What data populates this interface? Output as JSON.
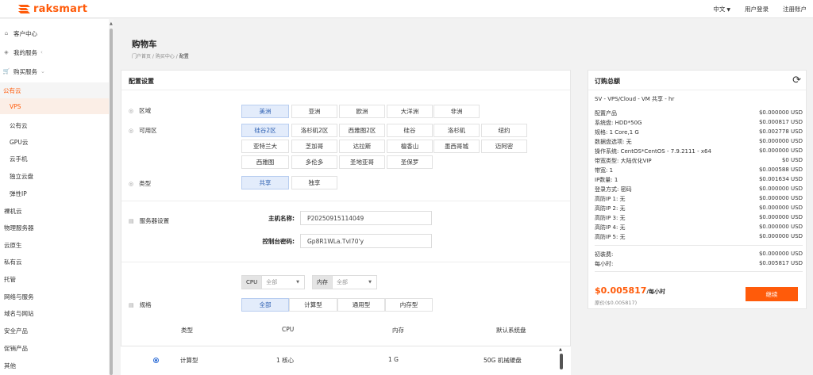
{
  "brand": {
    "name": "raksmart",
    "color": "#ff5b0a"
  },
  "topnav": {
    "language": "中文",
    "login": "用户登录",
    "register": "注册账户"
  },
  "sidebar": {
    "items": [
      {
        "label": "客户中心",
        "icon": "home-icon"
      },
      {
        "label": "我的服务",
        "icon": "cube-icon"
      },
      {
        "label": "购买服务",
        "icon": "cart-icon"
      },
      {
        "label": "公有云"
      },
      {
        "label": "VPS"
      },
      {
        "label": "公有云"
      },
      {
        "label": "GPU云"
      },
      {
        "label": "云手机"
      },
      {
        "label": "独立云盘"
      },
      {
        "label": "弹性IP"
      },
      {
        "label": "裸机云"
      },
      {
        "label": "物理服务器"
      },
      {
        "label": "云原生"
      },
      {
        "label": "私有云"
      },
      {
        "label": "托管"
      },
      {
        "label": "网络与服务"
      },
      {
        "label": "域名与网站"
      },
      {
        "label": "安全产品"
      },
      {
        "label": "促销产品"
      },
      {
        "label": "其他"
      }
    ]
  },
  "page": {
    "title": "购物车",
    "breadcrumb": [
      "门户首页",
      "购买中心",
      "配置"
    ]
  },
  "config": {
    "title": "配置设置",
    "region": {
      "label": "区域",
      "options": [
        "美洲",
        "亚洲",
        "欧洲",
        "大洋洲",
        "非洲"
      ],
      "selected": "美洲"
    },
    "zone": {
      "label": "可用区",
      "options": [
        "硅谷2区",
        "洛杉矶2区",
        "西雅图2区",
        "硅谷",
        "洛杉矶",
        "纽约",
        "亚特兰大",
        "芝加哥",
        "达拉斯",
        "檀香山",
        "墨西哥城",
        "迈阿密",
        "西雅图",
        "多伦多",
        "圣地亚哥",
        "圣保罗"
      ],
      "selected": "硅谷2区"
    },
    "type": {
      "label": "类型",
      "options": [
        "共享",
        "独享"
      ],
      "selected": "共享"
    },
    "server": {
      "label": "服务器设置",
      "hostname_label": "主机名称:",
      "hostname": "P20250915114049",
      "password_label": "控制台密码:",
      "password": "Gp8R1WLa.Tvl70'y"
    },
    "spec": {
      "label": "规格",
      "cpu_filter": {
        "label": "CPU",
        "value": "全部"
      },
      "mem_filter": {
        "label": "内存",
        "value": "全部"
      },
      "tabs": [
        "全部",
        "计算型",
        "通用型",
        "内存型"
      ],
      "selected_tab": "全部",
      "columns": [
        "类型",
        "CPU",
        "内存",
        "默认系统盘"
      ],
      "rows": [
        {
          "type": "计算型",
          "cpu": "1 核心",
          "mem": "1 G",
          "disk": "50G 机械硬盘"
        }
      ]
    }
  },
  "summary": {
    "title": "订购总额",
    "product": "SV - VPS/Cloud - VM 共享 - hr",
    "lines": [
      {
        "label": "配置产品",
        "value": "$0.000000 USD"
      },
      {
        "label": "系统盘: HDD*50G",
        "value": "$0.000817 USD"
      },
      {
        "label": "规格: 1 Core,1 G",
        "value": "$0.002778 USD"
      },
      {
        "label": "数据盘选项: 无",
        "value": "$0.000000 USD"
      },
      {
        "label": "操作系统: CentOS*CentOS - 7.9.2111 - x64",
        "value": "$0.000000 USD"
      },
      {
        "label": "带宽类型: 大陆优化VIP",
        "value": "$0 USD"
      },
      {
        "label": "带宽: 1",
        "value": "$0.000588 USD"
      },
      {
        "label": "IP数量: 1",
        "value": "$0.001634 USD"
      },
      {
        "label": "登录方式: 密码",
        "value": "$0.000000 USD"
      },
      {
        "label": "高防IP 1: 无",
        "value": "$0.000000 USD"
      },
      {
        "label": "高防IP 2: 无",
        "value": "$0.000000 USD"
      },
      {
        "label": "高防IP 3: 无",
        "value": "$0.000000 USD"
      },
      {
        "label": "高防IP 4: 无",
        "value": "$0.000000 USD"
      },
      {
        "label": "高防IP 5: 无",
        "value": "$0.000000 USD"
      }
    ],
    "setup": {
      "label": "初装费:",
      "value": "$0.000000 USD"
    },
    "hourly": {
      "label": "每小时:",
      "value": "$0.005817 USD"
    },
    "total": "$0.005817",
    "total_unit": "/每小时",
    "original": "原价($0.005817)",
    "continue": "继续"
  }
}
